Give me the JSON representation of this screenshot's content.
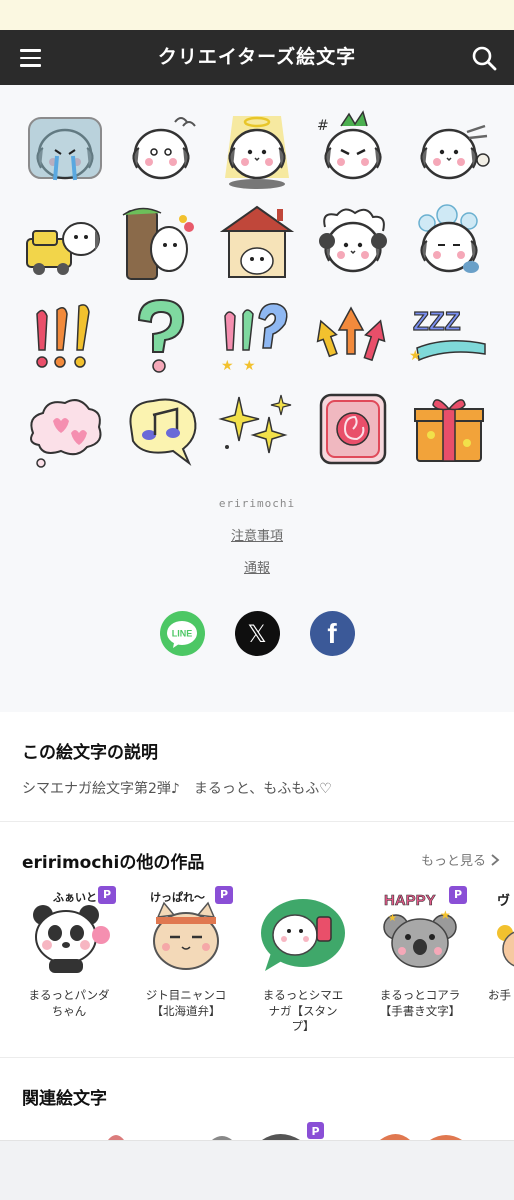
{
  "header": {
    "title": "クリエイターズ絵文字",
    "menu_icon": "hamburger-menu-icon",
    "search_icon": "search-icon"
  },
  "emoji_set": {
    "emojis": [
      {
        "name": "crying-bird-emoji"
      },
      {
        "name": "dizzy-bird-emoji"
      },
      {
        "name": "angel-bird-emoji"
      },
      {
        "name": "angry-bird-emoji"
      },
      {
        "name": "dashing-bird-emoji"
      },
      {
        "name": "bird-truck-emoji"
      },
      {
        "name": "bird-behind-tree-emoji"
      },
      {
        "name": "bird-house-emoji"
      },
      {
        "name": "sheep-bird-emoji"
      },
      {
        "name": "bath-bird-emoji"
      },
      {
        "name": "triple-exclamation-emoji"
      },
      {
        "name": "question-mark-emoji"
      },
      {
        "name": "exclamation-question-emoji"
      },
      {
        "name": "arrows-up-emoji"
      },
      {
        "name": "zzz-emoji"
      },
      {
        "name": "hearts-cloud-emoji"
      },
      {
        "name": "music-notes-emoji"
      },
      {
        "name": "sparkles-emoji"
      },
      {
        "name": "rose-square-emoji"
      },
      {
        "name": "gift-box-emoji"
      }
    ],
    "author": "eririmochi",
    "notice_link": "注意事項",
    "report_link": "通報"
  },
  "share": {
    "line_label": "LINE",
    "x_label": "𝕏",
    "facebook_label": "f"
  },
  "description": {
    "title": "この絵文字の説明",
    "text": "シマエナガ絵文字第2弾♪　まるっと、もふもふ♡"
  },
  "other_works": {
    "title": "eririmochiの他の作品",
    "more_label": "もっと見る",
    "premium_badge": "P",
    "items": [
      {
        "name": "まるっとパンダちゃん",
        "line1": "まるっとパンダ",
        "line2": "ちゃん",
        "line3": "",
        "caption": "ふぁいと"
      },
      {
        "name": "ジト目ニャンコ【北海道弁】",
        "line1": "ジト目ニャンコ",
        "line2": "【北海道弁】",
        "line3": "",
        "caption": "けっぱれ～"
      },
      {
        "name": "まるっとシマエナガ【スタンプ】",
        "line1": "まるっとシマエ",
        "line2": "ナガ【スタン",
        "line3": "プ】",
        "caption": ""
      },
      {
        "name": "まるっとコアラ【手書き文字】",
        "line1": "まるっとコアラ",
        "line2": "【手書き文字】",
        "line3": "",
        "caption": "HAPPY"
      },
      {
        "name": "お手",
        "line1": "お手",
        "line2": "",
        "line3": "",
        "caption": "ヴ"
      }
    ]
  },
  "related": {
    "title": "関連絵文字"
  },
  "colors": {
    "header_bg": "#2b2b2b",
    "notice_bg": "#fbf8e1",
    "line_green": "#4cc764",
    "facebook_blue": "#3b5998",
    "premium_purple": "#8a4fd6"
  }
}
